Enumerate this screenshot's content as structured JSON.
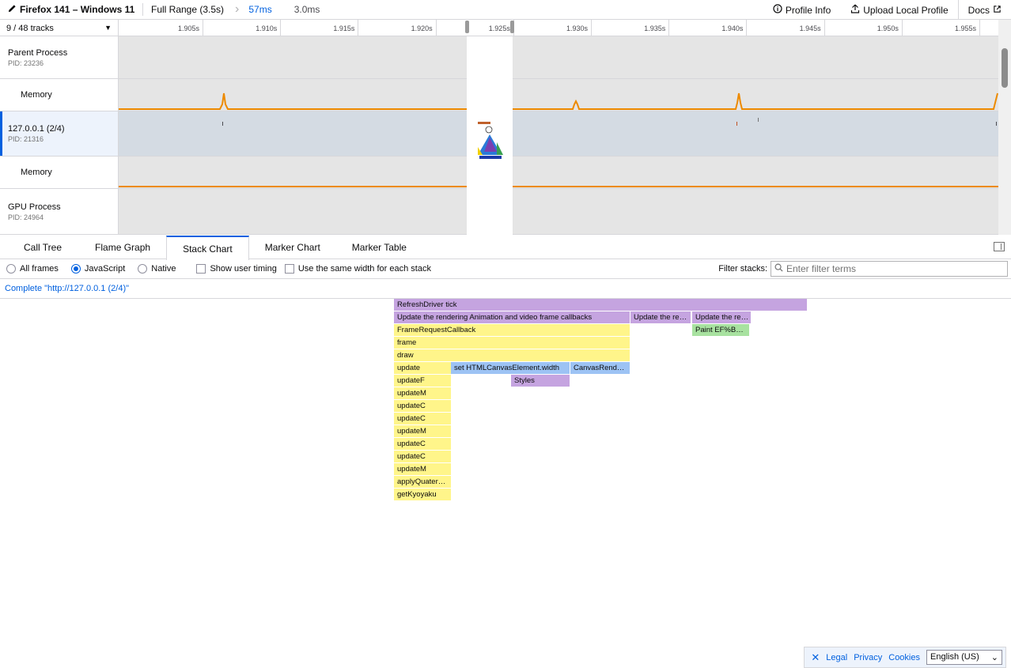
{
  "topbar": {
    "app_title": "Firefox 141 – Windows 11",
    "full_range": "Full Range (3.5s)",
    "selected_range": "57ms",
    "preview_range": "3.0ms",
    "profile_info": "Profile Info",
    "upload": "Upload Local Profile",
    "docs": "Docs"
  },
  "timeline": {
    "track_count": "9 / 48 tracks",
    "ticks": [
      "1.905s",
      "1.910s",
      "1.915s",
      "1.920s",
      "1.925s",
      "1.930s",
      "1.935s",
      "1.940s",
      "1.945s",
      "1.950s",
      "1.955s"
    ],
    "tracks": [
      {
        "name": "Parent Process",
        "pid": "PID: 23236"
      },
      {
        "name": "Memory"
      },
      {
        "name": "127.0.0.1 (2/4)",
        "pid": "PID: 21316"
      },
      {
        "name": "Memory"
      },
      {
        "name": "GPU Process",
        "pid": "PID: 24964"
      }
    ],
    "memory_color": "#ed8a00",
    "selection_color": "#ffffff"
  },
  "tabs": [
    "Call Tree",
    "Flame Graph",
    "Stack Chart",
    "Marker Chart",
    "Marker Table"
  ],
  "active_tab": "Stack Chart",
  "settings": {
    "all_frames": "All frames",
    "javascript": "JavaScript",
    "native": "Native",
    "show_user_timing": "Show user timing",
    "same_width": "Use the same width for each stack",
    "filter_label": "Filter stacks:",
    "filter_placeholder": "Enter filter terms"
  },
  "breadcrumb": "Complete \"http://127.0.0.1 (2/4)\"",
  "stack": {
    "row0": [
      "RefreshDriver tick"
    ],
    "row1": [
      "Update the rendering Animation and video frame callbacks",
      "Update the re…",
      "Update the re…"
    ],
    "row2": [
      "FrameRequestCallback",
      "Paint EF%B…"
    ],
    "row3": [
      "frame"
    ],
    "row4": [
      "draw"
    ],
    "row5": [
      "update",
      "set HTMLCanvasElement.width",
      "CanvasRend…"
    ],
    "row6": [
      "updateF",
      "Styles"
    ],
    "deep": [
      "updateM",
      "updateC",
      "updateC",
      "updateM",
      "updateC",
      "updateC",
      "updateM",
      "applyQuater…",
      "getKyoyaku"
    ]
  },
  "footer": {
    "legal": "Legal",
    "privacy": "Privacy",
    "cookies": "Cookies",
    "language": "English (US)"
  }
}
